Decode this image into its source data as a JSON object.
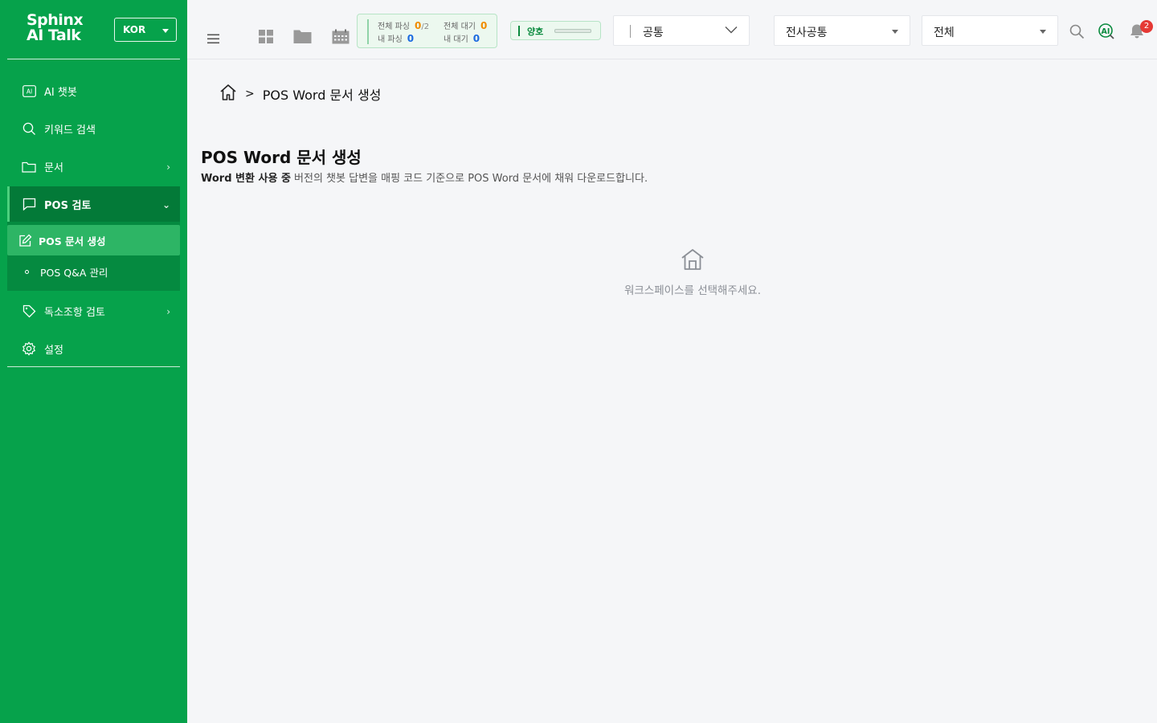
{
  "brand": {
    "line1": "Sphinx",
    "line2": "AI Talk",
    "language": "KOR"
  },
  "sidebar": {
    "items": [
      {
        "label": "AI 챗봇",
        "icon": "ai-icon"
      },
      {
        "label": "키워드 검색",
        "icon": "search-icon"
      },
      {
        "label": "문서",
        "icon": "folder-icon"
      },
      {
        "label": "POS 검토",
        "icon": "chat-icon"
      },
      {
        "label": "독소조항 검토",
        "icon": "tag-icon"
      },
      {
        "label": "설정",
        "icon": "gear-icon"
      }
    ],
    "pos_sub": [
      {
        "label": "POS 문서 생성",
        "icon": "edit-icon"
      },
      {
        "label": "POS Q&A 관리"
      }
    ]
  },
  "header": {
    "status": {
      "total_parse_label": "전체 파싱",
      "total_parse_value": "0",
      "total_parse_max": "/2",
      "my_parse_label": "내 파싱",
      "my_parse_value": "0",
      "total_wait_label": "전체 대기",
      "total_wait_value": "0",
      "my_wait_label": "내 대기",
      "my_wait_value": "0"
    },
    "health": {
      "label": "양호",
      "level": 0
    },
    "select_common": "공통",
    "select_company": "전사공통",
    "select_all": "전체",
    "notification_count": "2"
  },
  "breadcrumb": {
    "current": "POS Word 문서 생성"
  },
  "page": {
    "title": "POS Word 문서 생성",
    "desc_bold": "Word 변환 사용 중",
    "desc_rest": " 버전의 챗봇 답변을 매핑 코드 기준으로 POS Word 문서에 채워 다운로드합니다.",
    "empty_text": "워크스페이스를 선택해주세요."
  },
  "colors": {
    "sidebar": "#06a24b",
    "sidebar_active": "#037a38",
    "accent": "#2db565",
    "badge": "#e53935"
  }
}
